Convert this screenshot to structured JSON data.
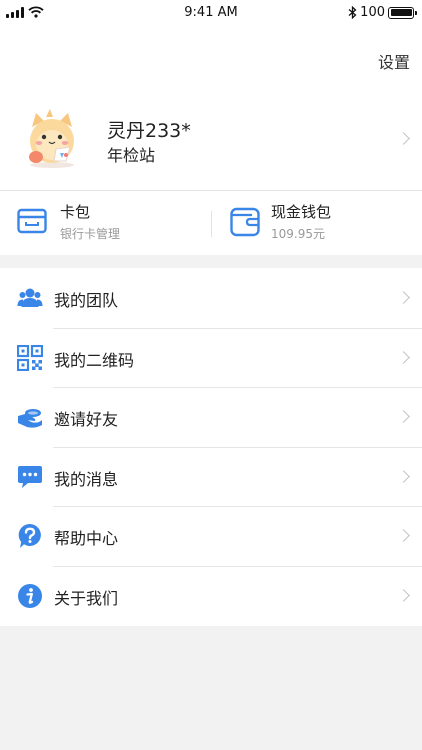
{
  "status_bar": {
    "time": "9:41 AM",
    "battery": "100"
  },
  "header": {
    "settings_label": "设置"
  },
  "profile": {
    "name": "灵丹233*",
    "subtitle": "年检站"
  },
  "wallet": {
    "card": {
      "title": "卡包",
      "subtitle": "银行卡管理"
    },
    "cash": {
      "title": "现金钱包",
      "subtitle": "109.95元"
    }
  },
  "menu": {
    "items": [
      {
        "label": "我的团队",
        "icon": "team-icon"
      },
      {
        "label": "我的二维码",
        "icon": "qr-code-icon"
      },
      {
        "label": "邀请好友",
        "icon": "invite-hand-icon"
      },
      {
        "label": "我的消息",
        "icon": "message-icon"
      },
      {
        "label": "帮助中心",
        "icon": "help-icon"
      },
      {
        "label": "关于我们",
        "icon": "info-icon"
      }
    ]
  },
  "colors": {
    "accent": "#3a86e8",
    "background": "#f2f2f2"
  }
}
